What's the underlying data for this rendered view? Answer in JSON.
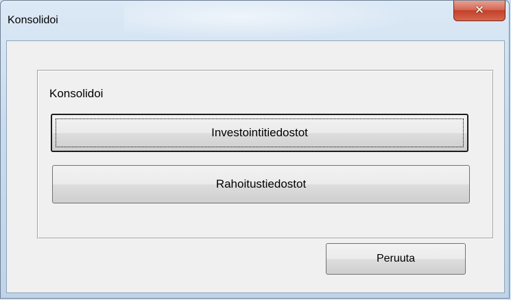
{
  "window": {
    "title": "Konsolidoi",
    "close_symbol": "✕",
    "close_icon": "close-icon"
  },
  "group": {
    "caption": "Konsolidoi",
    "buttons": {
      "investments_label": "Investointitiedostot",
      "financing_label": "Rahoitustiedostot"
    }
  },
  "footer": {
    "cancel_label": "Peruuta"
  },
  "colors": {
    "close_button": "#c2412a",
    "client_background": "#f0f0f0",
    "frame_background": "#c9dcee"
  }
}
